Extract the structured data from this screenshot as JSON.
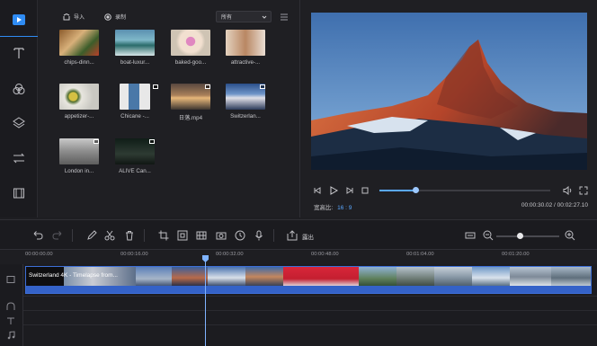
{
  "library": {
    "import_label": "导入",
    "record_label": "录制",
    "filter_value": "所有",
    "items": [
      {
        "caption": "chips-dinn..."
      },
      {
        "caption": "boat-luxur..."
      },
      {
        "caption": "baked-goo..."
      },
      {
        "caption": "attractive-..."
      },
      {
        "caption": "appetizer-..."
      },
      {
        "caption": "Chicane -..."
      },
      {
        "caption": "日落.mp4"
      },
      {
        "caption": "Switzerlan..."
      },
      {
        "caption": "London in..."
      },
      {
        "caption": "ALIVE  Can..."
      }
    ]
  },
  "preview": {
    "ratio_label": "宽高比",
    "ratio_value": "16 : 9",
    "current_time": "00:00:30.02",
    "separator": " / ",
    "total_time": "00:02:27.10",
    "progress": 0.21
  },
  "timeline": {
    "export_label": "露出",
    "ruler": [
      "00:00:00.00",
      "00:00:16.00",
      "00:00:32.00",
      "00:00:48.00",
      "00:01:04.00",
      "00:01:20.00"
    ],
    "clip_title": "Switzerland 4K - Timelapse from..."
  },
  "colors": {
    "accent": "#2f8cf4",
    "clip": "#3462c8",
    "bg": "#1e1e22"
  }
}
